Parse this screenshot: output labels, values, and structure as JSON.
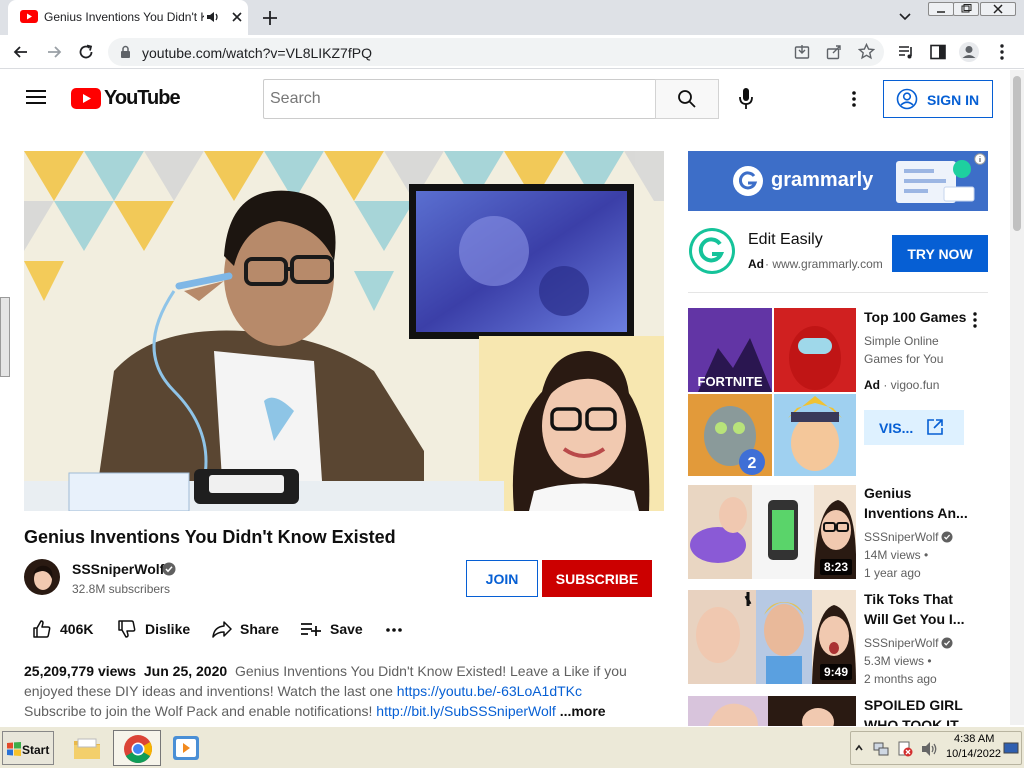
{
  "browser": {
    "tab_title": "Genius Inventions You Didn't Know Existed",
    "url": "youtube.com/watch?v=VL8LIKZ7fPQ"
  },
  "header": {
    "logo_text": "YouTube",
    "search_placeholder": "Search",
    "sign_in_label": "SIGN IN"
  },
  "video": {
    "title": "Genius Inventions You Didn't Know Existed",
    "channel": "SSSniperWolf",
    "subscribers": "32.8M subscribers",
    "join_label": "JOIN",
    "subscribe_label": "SUBSCRIBE",
    "likes": "406K",
    "dislike_label": "Dislike",
    "share_label": "Share",
    "save_label": "Save",
    "views": "25,209,779 views",
    "date": "Jun 25, 2020",
    "desc_1": "Genius Inventions You Didn't Know Existed! Leave a Like if you",
    "desc_2": "enjoyed these DIY ideas and inventions! Watch the last one",
    "desc_link_1": "https://youtu.be/-63LoA1dTKc",
    "desc_3": "Subscribe to join the Wolf Pack and enable notifications!",
    "desc_link_2": "http://bit.ly/SubSSSniperWolf",
    "more_label": "...more"
  },
  "sidebar": {
    "ad_banner_brand": "grammarly",
    "ad_headline": "Edit Easily",
    "ad_label": "Ad",
    "ad_domain": "www.grammarly.com",
    "try_now_label": "TRY NOW",
    "game_ad": {
      "title": "Top 100 Games",
      "line1": "Simple Online",
      "line2": "Games for You",
      "ad_label": "Ad",
      "domain": "vigoo.fun",
      "visit_label": "VIS...",
      "tile_fortnite": "FORTNITE",
      "tile_badge": "2"
    },
    "recs": [
      {
        "title_1": "Genius",
        "title_2": "Inventions An...",
        "channel": "SSSniperWolf",
        "views": "14M views •",
        "age": "1 year ago",
        "duration": "8:23"
      },
      {
        "title_1": "Tik Toks That",
        "title_2": "Will Get You I...",
        "channel": "SSSniperWolf",
        "views": "5.3M views •",
        "age": "2 months ago",
        "duration": "9:49"
      },
      {
        "title_1": "SPOILED GIRL",
        "title_2": "WHO TOOK IT"
      }
    ]
  },
  "taskbar": {
    "start_label": "Start",
    "time": "4:38 AM",
    "date": "10/14/2022"
  }
}
